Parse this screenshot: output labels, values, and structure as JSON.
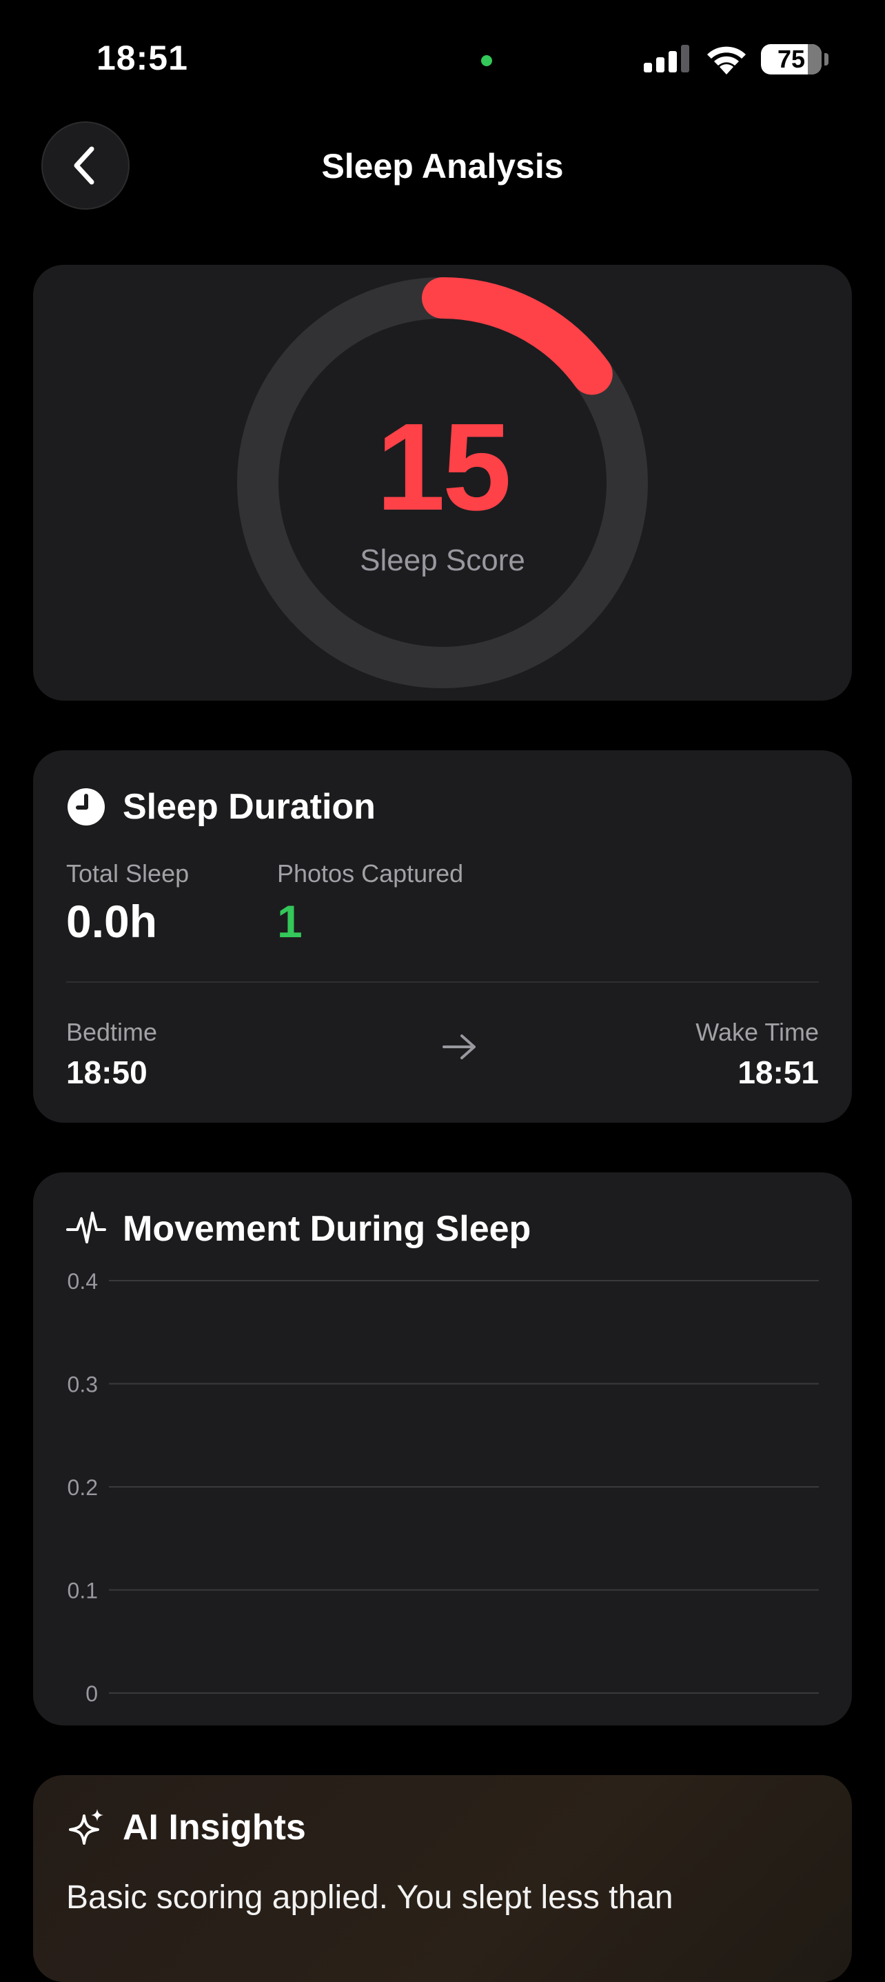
{
  "status_bar": {
    "time": "18:51",
    "battery_level": "75",
    "signal_icon": "cellular-signal-icon",
    "wifi_icon": "wifi-icon"
  },
  "nav": {
    "title": "Sleep Analysis",
    "back_icon": "chevron-left-icon"
  },
  "score": {
    "value": "15",
    "label": "Sleep Score",
    "progress": 0.15,
    "color": "#ff4148",
    "track_color": "#323234"
  },
  "duration": {
    "title": "Sleep Duration",
    "icon": "clock-icon",
    "total_sleep_label": "Total Sleep",
    "total_sleep_value": "0.0h",
    "photos_label": "Photos Captured",
    "photos_value": "1",
    "photos_color": "#34c759",
    "bedtime_label": "Bedtime",
    "bedtime_value": "18:50",
    "wake_label": "Wake Time",
    "wake_value": "18:51",
    "arrow_icon": "arrow-right-icon"
  },
  "movement": {
    "title": "Movement During Sleep",
    "icon": "waveform-icon"
  },
  "chart_data": {
    "type": "line",
    "title": "Movement During Sleep",
    "xlabel": "",
    "ylabel": "",
    "ylim": [
      0,
      0.4
    ],
    "y_ticks": [
      "0.4",
      "0.3",
      "0.2",
      "0.1",
      "0"
    ],
    "series": [],
    "grid": true
  },
  "insights": {
    "title": "AI Insights",
    "icon": "sparkles-icon",
    "text": "Basic scoring applied. You slept less than"
  }
}
